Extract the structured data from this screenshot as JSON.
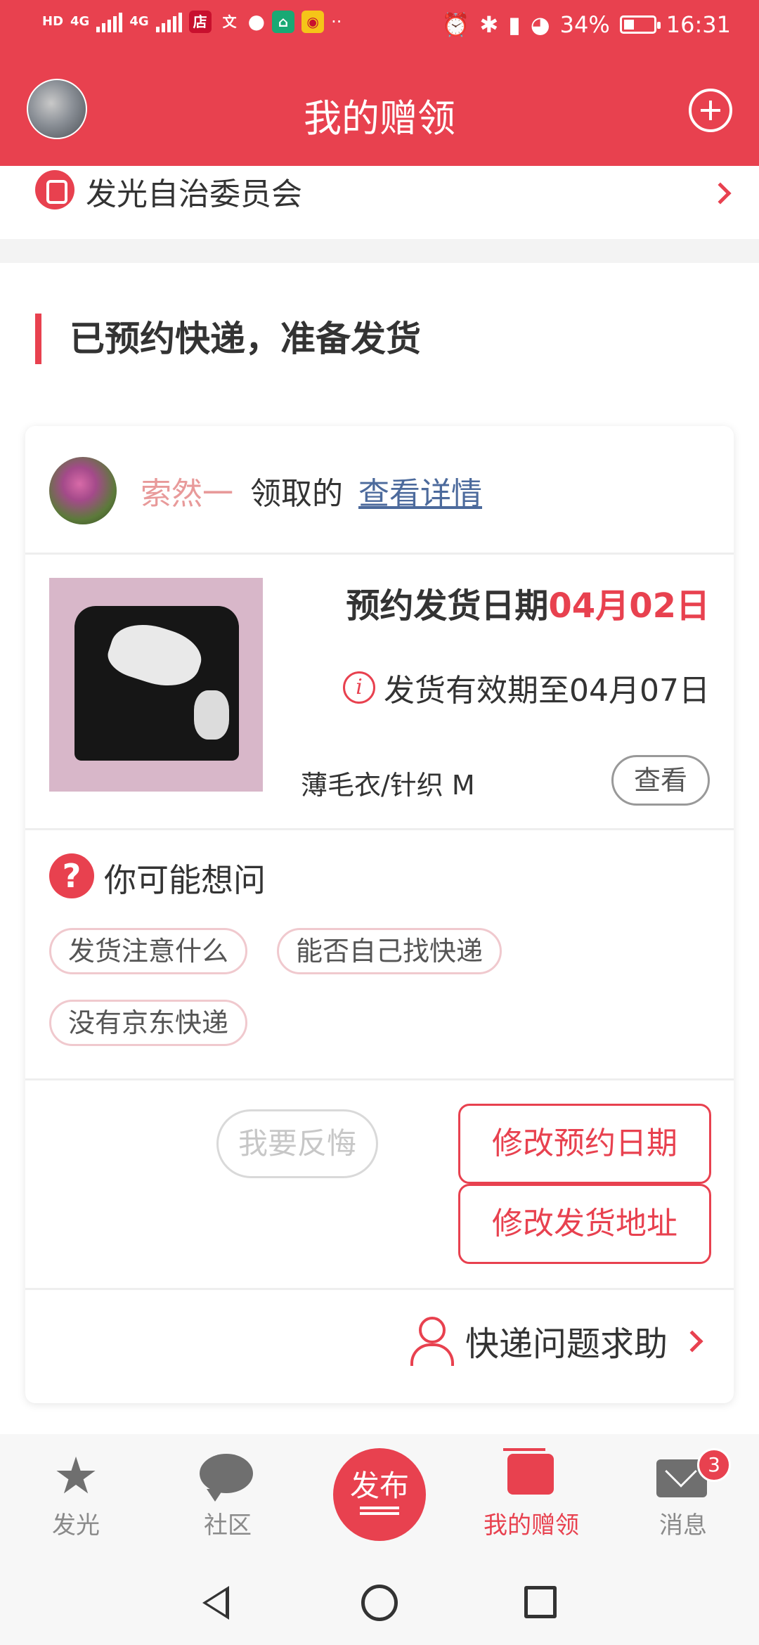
{
  "status_bar": {
    "left_labels": [
      "HD",
      "4G",
      "4G",
      "店",
      "文"
    ],
    "battery": "34%",
    "time": "16:31"
  },
  "header": {
    "title": "我的赠领",
    "icons": [
      "user-avatar",
      "add-icon"
    ]
  },
  "committee": {
    "label": "发光自治委员会"
  },
  "section": {
    "title": "已预约快递，准备发货"
  },
  "card": {
    "claimer": {
      "name": "索然一",
      "action": "领取的",
      "link": "查看详情"
    },
    "shipment": {
      "date_label": "预约发货日期",
      "date_value": "04月02日",
      "valid_text": "发货有效期至04月07日",
      "info_icon": "i"
    },
    "item": {
      "name": "薄毛衣/针织 M",
      "view_label": "查看"
    },
    "faq": {
      "icon": "?",
      "title": "你可能想问",
      "chips": [
        "发货注意什么",
        "能否自己找快递",
        "没有京东快递"
      ]
    },
    "actions": {
      "regret": "我要反悔",
      "change_date": "修改预约日期",
      "change_address": "修改发货地址"
    },
    "help": {
      "label": "快递问题求助"
    }
  },
  "tabbar": {
    "tabs": [
      {
        "label": "发光",
        "icon": "star-icon"
      },
      {
        "label": "社区",
        "icon": "chat-bubble-icon"
      },
      {
        "label": "发布",
        "icon": "publish-icon"
      },
      {
        "label": "我的赠领",
        "icon": "gift-box-icon",
        "active": true
      },
      {
        "label": "消息",
        "icon": "mail-icon",
        "badge": "3"
      }
    ]
  },
  "colors": {
    "accent": "#e8414f",
    "link": "#4c6a9c",
    "claimer_name": "#e89a9a"
  }
}
